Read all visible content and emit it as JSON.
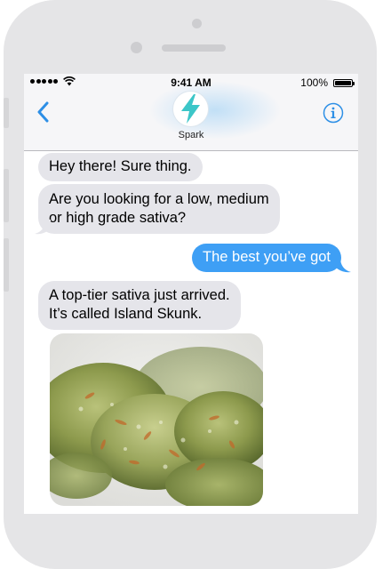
{
  "status_bar": {
    "time": "9:41 AM",
    "battery": "100%",
    "wifi_icon": "wifi-icon",
    "battery_icon": "battery-icon"
  },
  "header": {
    "contact_name": "Spark",
    "back_icon": "chevron-left-icon",
    "info_icon": "info-icon",
    "avatar_icon": "lightning-bolt-icon",
    "accent": "#2d8fe6",
    "avatar_color": "#3cc6c8"
  },
  "messages": [
    {
      "direction": "incoming",
      "lines": [
        "Hey there! Sure thing."
      ]
    },
    {
      "direction": "incoming",
      "lines": [
        "Are you looking for a low, medium",
        "or high grade sativa?"
      ]
    },
    {
      "direction": "outgoing",
      "lines": [
        "The best you’ve got"
      ]
    },
    {
      "direction": "incoming",
      "lines": [
        "A top-tier sativa just arrived.",
        "It’s called Island Skunk."
      ]
    },
    {
      "direction": "incoming",
      "type": "image",
      "image": "cannabis-bud-photo"
    }
  ],
  "colors": {
    "incoming_bubble": "#e5e5ea",
    "outgoing_bubble": "#3e9ff5",
    "device_frame": "#e5e5e7"
  }
}
